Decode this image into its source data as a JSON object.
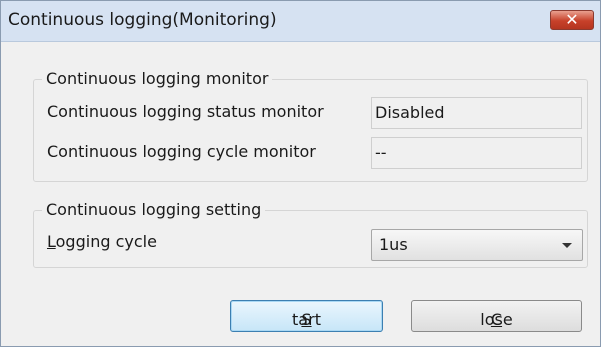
{
  "window": {
    "title": "Continuous logging(Monitoring)",
    "close_label": "✕"
  },
  "monitor_group": {
    "title": "Continuous logging monitor",
    "status_label": "Continuous logging status monitor",
    "status_value": "Disabled",
    "cycle_label": "Continuous logging cycle monitor",
    "cycle_value": "--"
  },
  "setting_group": {
    "title": "Continuous logging setting",
    "logging_cycle_mnemonic": "L",
    "logging_cycle_rest": "ogging cycle",
    "logging_cycle_value": "1us"
  },
  "buttons": {
    "start_mnemonic": "S",
    "start_rest": "tart",
    "close_mnemonic": "C",
    "close_rest": "lose"
  },
  "colors": {
    "titlebar": "#d6e2f2",
    "close_button": "#c7412a",
    "dialog_bg": "#f0f0f0",
    "default_button_border": "#3c7fb1"
  }
}
